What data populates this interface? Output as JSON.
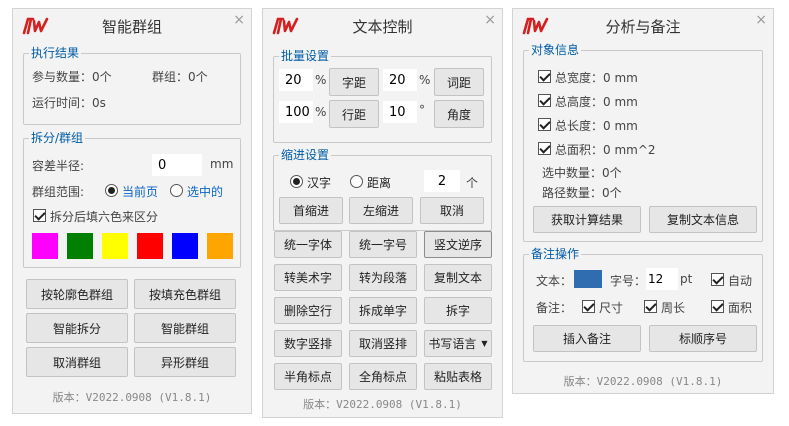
{
  "panel1": {
    "title": "智能群组",
    "close": "×",
    "result": {
      "legend": "执行结果",
      "count_label": "参与数量：0个",
      "group_label": "群组：0个",
      "time_label": "运行时间：0s"
    },
    "split": {
      "legend": "拆分/群组",
      "radius_label": "容差半径:",
      "radius_value": "0",
      "radius_unit": "mm",
      "scope_label": "群组范围:",
      "scope_current": "当前页",
      "scope_selected": "选中的",
      "six_color_label": "拆分后填六色来区分",
      "swatch_colors": [
        "#ff00ff",
        "#008000",
        "#ffff00",
        "#ff0000",
        "#0000ff",
        "#ffa500"
      ]
    },
    "buttons": {
      "outline_group": "按轮廓色群组",
      "fill_group": "按填充色群组",
      "smart_split": "智能拆分",
      "smart_group": "智能群组",
      "ungroup": "取消群组",
      "shape_group": "异形群组"
    },
    "version_label": "版本：",
    "version_value": "V2022.0908 (V1.8.1)"
  },
  "panel2": {
    "title": "文本控制",
    "close": "×",
    "batch": {
      "legend": "批量设置",
      "char_spacing_pct": "20",
      "word_spacing_pct": "20",
      "line_spacing_pct": "100",
      "angle_value": "10",
      "pct": "%",
      "deg": "°",
      "char_spacing_btn": "字距",
      "word_spacing_btn": "词距",
      "line_spacing_btn": "行距",
      "angle_btn": "角度"
    },
    "indent": {
      "legend": "缩进设置",
      "opt_hanzi": "汉字",
      "opt_distance": "距离",
      "value": "2",
      "unit": "个",
      "first_indent": "首缩进",
      "left_indent": "左缩进",
      "cancel": "取消"
    },
    "buttons": {
      "unify_font": "统一字体",
      "unify_size": "统一字号",
      "vertical_reverse": "竖文逆序",
      "to_art_text": "转美术字",
      "to_paragraph": "转为段落",
      "copy_text": "复制文本",
      "delete_empty_lines": "删除空行",
      "split_single_chars": "拆成单字",
      "split_chars": "拆字",
      "number_vertical": "数字竖排",
      "cancel_vertical": "取消竖排",
      "writing_language": "书写语言",
      "half_width_punct": "半角标点",
      "full_width_punct": "全角标点",
      "paste_table": "粘贴表格"
    },
    "version_label": "版本：",
    "version_value": "V2022.0908 (V1.8.1)"
  },
  "panel3": {
    "title": "分析与备注",
    "close": "×",
    "info": {
      "legend": "对象信息",
      "total_width": "总宽度：0 mm",
      "total_height": "总高度：0 mm",
      "total_length": "总长度：0 mm",
      "total_area": "总面积：0 mm^2",
      "selected_count": "选中数量：0个",
      "path_count": "路径数量：0个",
      "get_result": "获取计算结果",
      "copy_info": "复制文本信息"
    },
    "note": {
      "legend": "备注操作",
      "text_label": "文本：",
      "text_color": "#2f6db0",
      "size_label": "字号：",
      "size_value": "12",
      "size_unit": "pt",
      "auto_label": "自动",
      "note_label": "备注：",
      "size_opt": "尺寸",
      "perimeter_opt": "周长",
      "area_opt": "面积",
      "insert_note": "插入备注",
      "label_sequence": "标顺序号"
    },
    "version_label": "版本：",
    "version_value": "V2022.0908 (V1.8.1)"
  }
}
